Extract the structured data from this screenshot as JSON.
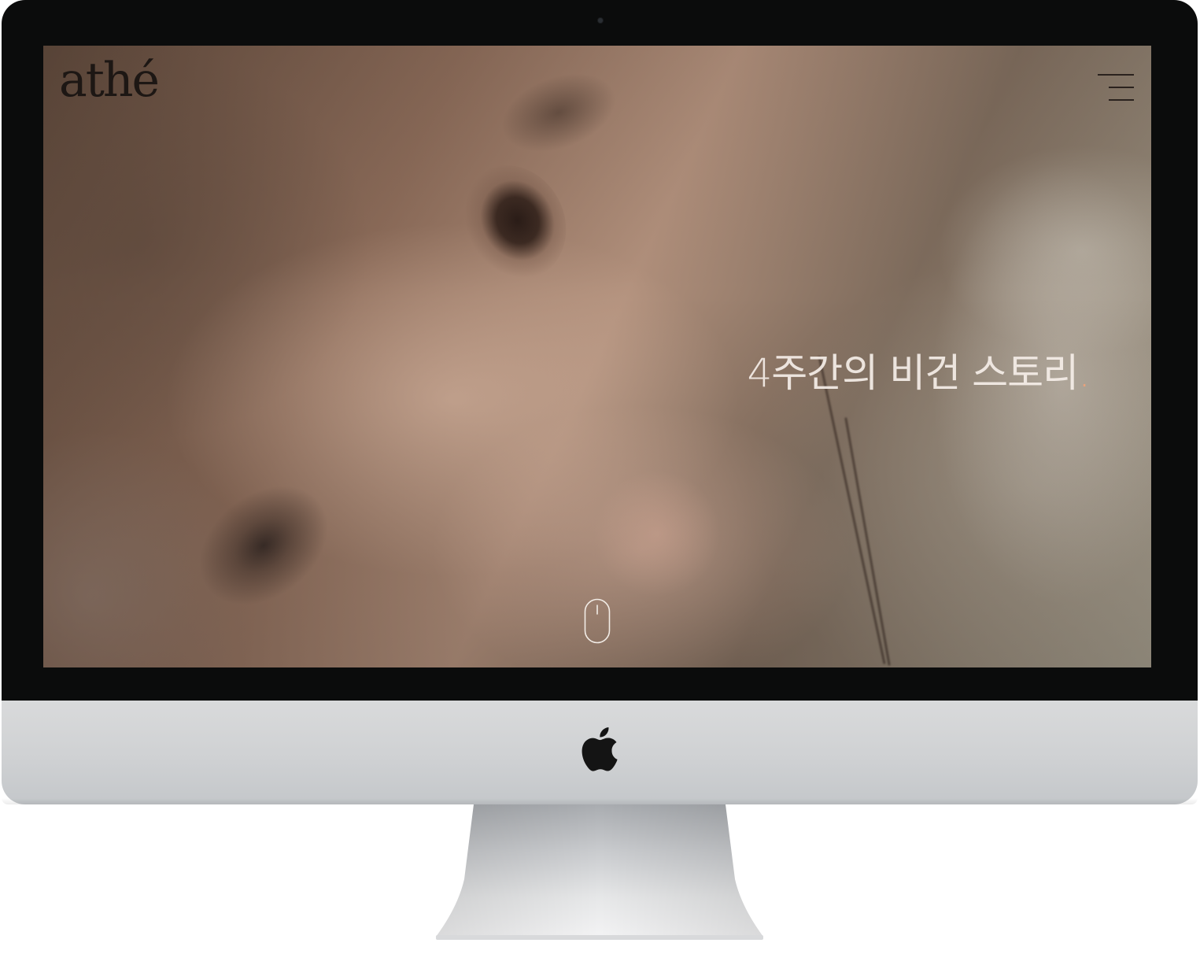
{
  "site": {
    "logo_text": "athé",
    "menu_icon": "hamburger-menu-icon",
    "hero_tagline": "4주간의 비건 스토리",
    "hero_tagline_end": ".",
    "scroll_icon": "mouse-scroll-icon"
  },
  "device": {
    "brand_icon": "apple-logo-icon"
  },
  "colors": {
    "tagline": "#f5eee8",
    "tagline_dot": "#e9a27c",
    "logo": "#1d1714",
    "bezel": "#0b0c0c",
    "chin": "#d2d4d6"
  }
}
